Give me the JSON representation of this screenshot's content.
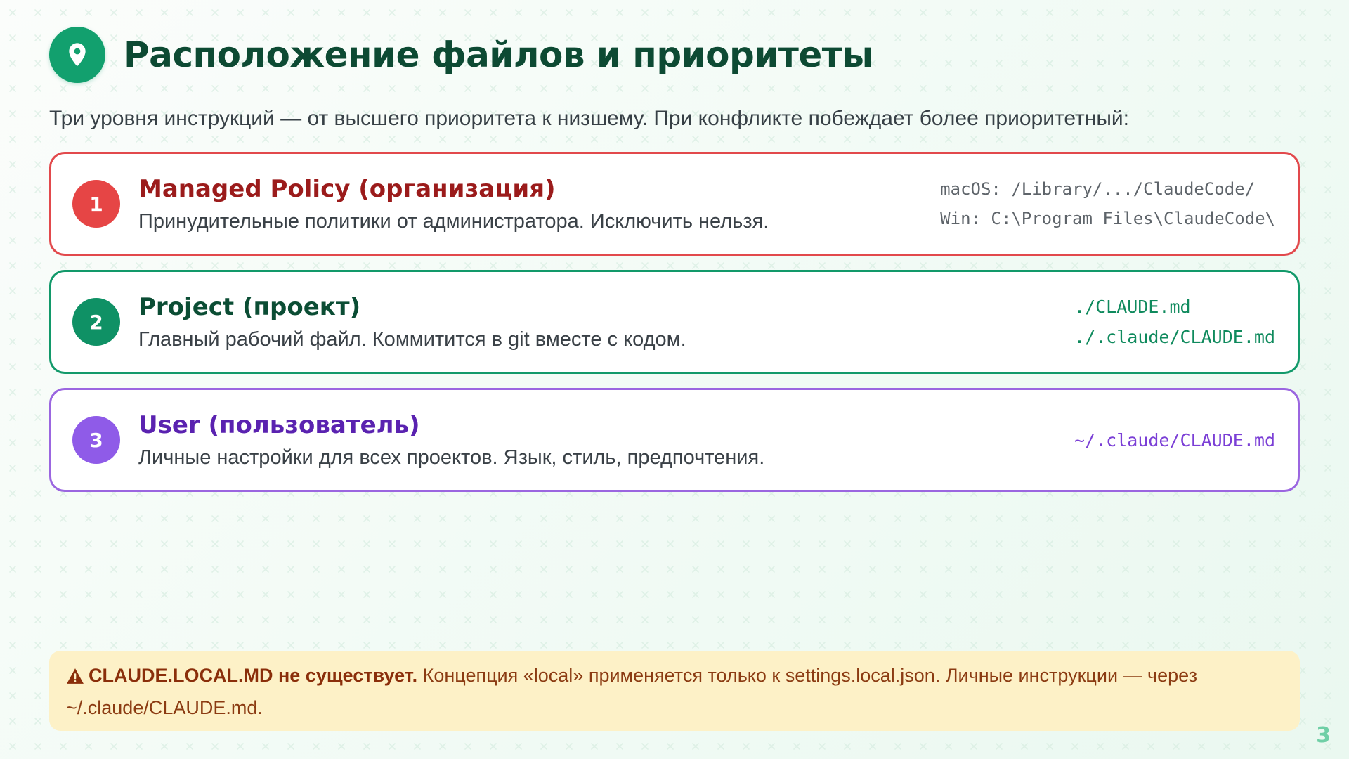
{
  "header": {
    "icon": "map-pin-icon",
    "title": "Расположение файлов и приоритеты"
  },
  "subtitle": "Три уровня инструкций — от высшего приоритета к низшему. При конфликте побеждает более приоритетный:",
  "levels": [
    {
      "number": "1",
      "title": "Managed Policy (организация)",
      "description": "Принудительные политики от администратора. Исключить нельзя.",
      "paths": [
        "macOS: /Library/.../ClaudeCode/",
        "Win: C:\\Program Files\\ClaudeCode\\"
      ],
      "color": "#e64545"
    },
    {
      "number": "2",
      "title": "Project (проект)",
      "description": "Главный рабочий файл. Коммитится в git вместе с кодом.",
      "paths": [
        "./CLAUDE.md",
        "./.claude/CLAUDE.md"
      ],
      "color": "#0f9165"
    },
    {
      "number": "3",
      "title": "User (пользователь)",
      "description": "Личные настройки для всех проектов. Язык, стиль, предпочтения.",
      "paths": [
        "~/.claude/CLAUDE.md"
      ],
      "color": "#8f5be8"
    }
  ],
  "warning": {
    "icon": "warning-triangle-icon",
    "strong": "CLAUDE.LOCAL.MD не существует.",
    "text": "Концепция «local» применяется только к settings.local.json. Личные инструкции — через ~/.claude/CLAUDE.md."
  },
  "page_number": "3",
  "colors": {
    "accent": "#12a06e",
    "title": "#0d4a33",
    "warning_bg": "#fdf1c7"
  }
}
